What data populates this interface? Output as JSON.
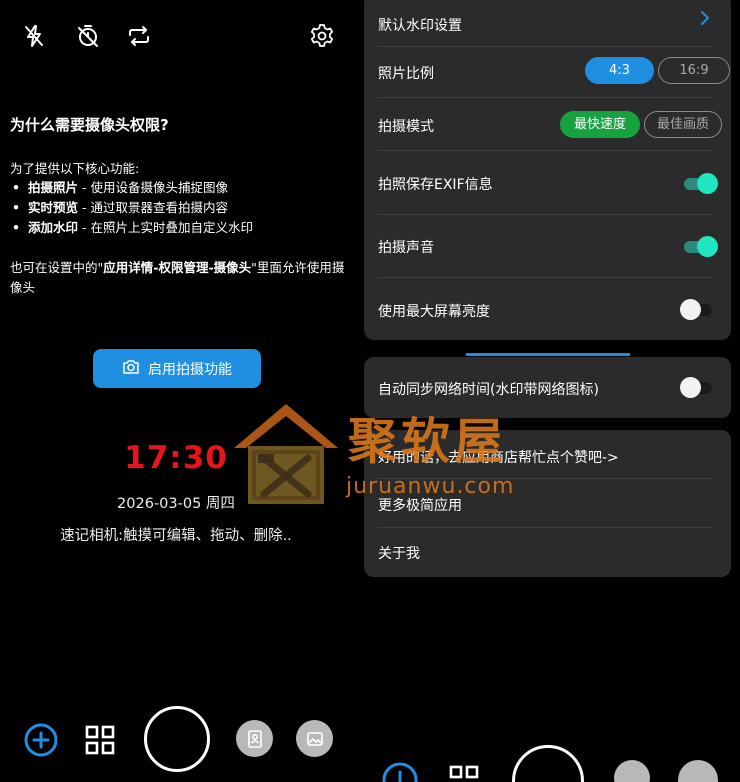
{
  "left": {
    "permission_title": "为什么需要摄像头权限?",
    "permission_intro": "为了提供以下核心功能:",
    "features": [
      {
        "name": "拍摄照片",
        "desc": " - 使用设备摄像头捕捉图像"
      },
      {
        "name": "实时预览",
        "desc": " - 通过取景器查看拍摄内容"
      },
      {
        "name": "添加水印",
        "desc": " - 在照片上实时叠加自定义水印"
      }
    ],
    "bullet": "•",
    "note_prefix": "也可在设置中的\"",
    "note_bold": "应用详情-权限管理-摄像头",
    "note_suffix": "\"里面允许使用摄像头",
    "enable_button": "启用拍摄功能",
    "clock": "17:30",
    "date": "2026-03-05 周四",
    "memo": "速记相机:触摸可编辑、拖动、删除.."
  },
  "settings": {
    "watermark_settings": "默认水印设置",
    "photo_ratio": {
      "label": "照片比例",
      "options": [
        "4:3",
        "16:9"
      ],
      "selected": "4:3"
    },
    "shoot_mode": {
      "label": "拍摄模式",
      "options": [
        "最快速度",
        "最佳画质"
      ],
      "selected": "最快速度"
    },
    "exif": {
      "label": "拍照保存EXIF信息",
      "on": true
    },
    "sound": {
      "label": "拍摄声音",
      "on": true
    },
    "max_brightness": {
      "label": "使用最大屏幕亮度",
      "on": false
    },
    "sync_time": {
      "label": "自动同步网络时间(水印带网络图标)",
      "on": false
    },
    "rate_app": "好用的话，去应用商店帮忙点个赞吧->",
    "more_apps": "更多极简应用",
    "about": "关于我"
  },
  "watermark": {
    "brand": "聚软屋",
    "domain": "juruanwu.com"
  },
  "colors": {
    "accent_blue": "#1e8fe1",
    "accent_green": "#16a33f",
    "toggle_on": "#1fe5c2",
    "clock_red": "#e8141c",
    "watermark_orange": "#db771a"
  },
  "icons": [
    "flash-off-icon",
    "timer-off-icon",
    "switch-camera-icon",
    "settings-gear-icon",
    "camera-icon",
    "add-circle-icon",
    "grid-icon",
    "shutter-button",
    "portrait-gallery-icon",
    "image-gallery-icon",
    "chevron-right-icon"
  ]
}
